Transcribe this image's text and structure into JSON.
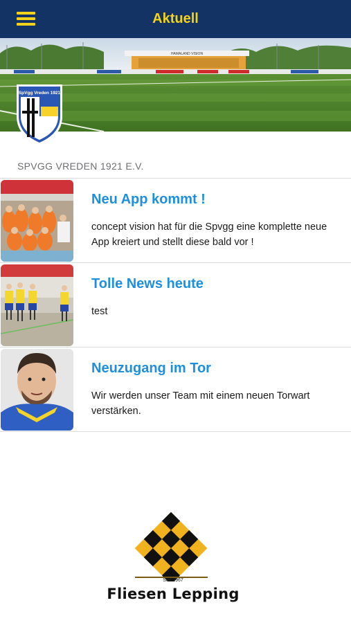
{
  "header": {
    "title": "Aktuell",
    "menu_icon": "hamburger-menu-icon",
    "background": "#123363",
    "accent": "#f3d21c"
  },
  "banner": {
    "stadium_sign": "HAMALAND VISION",
    "crest": {
      "text": "SpVgg Vreden 1921",
      "colors": [
        "#2b57b4",
        "#f6d22a",
        "#ffffff"
      ]
    }
  },
  "section": {
    "club_name": "SPVGG VREDEN 1921 E.V."
  },
  "news": [
    {
      "title": "Neu App kommt !",
      "text": "concept vision hat für die Spvgg eine komplette neue App kreiert und stellt diese bald vor !"
    },
    {
      "title": "Tolle News heute",
      "text": "test"
    },
    {
      "title": "Neuzugang im Tor",
      "text": "Wir werden unser Team mit einem neuen Torwart verstärken."
    }
  ],
  "sponsor": {
    "since": "Seit 1967",
    "name": "Fliesen Lepping"
  }
}
